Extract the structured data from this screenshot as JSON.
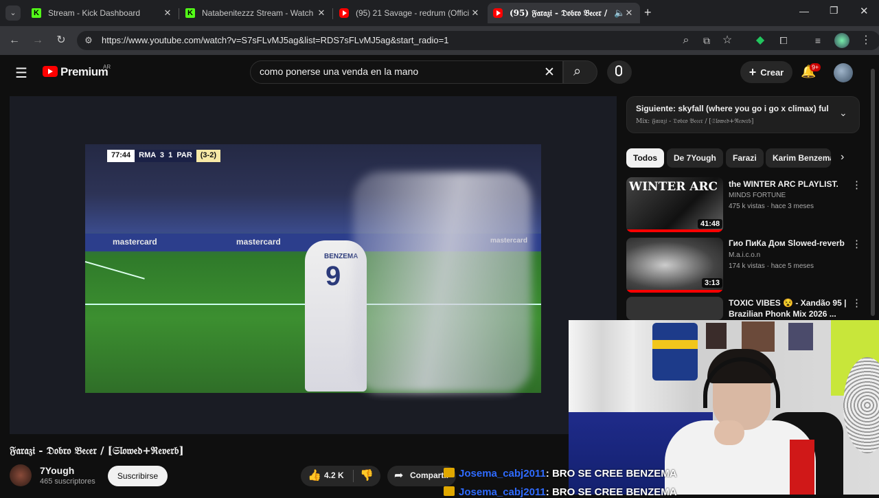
{
  "browser": {
    "tabs": [
      {
        "title": "Stream - Kick Dashboard",
        "favicon": "kick-icon",
        "active": false
      },
      {
        "title": "Natabenitezzz Stream - Watch L",
        "favicon": "kick-icon",
        "active": false
      },
      {
        "title": "(95) 21 Savage - redrum (Offici",
        "favicon": "youtube-icon",
        "active": false
      },
      {
        "title": "(95) 𝔉𝔞𝔯𝔞𝔷𝔦 - 𝔇𝔬𝔟𝔯𝔬 𝔅𝔢𝔠𝔢𝔯 /",
        "favicon": "youtube-icon",
        "active": true
      }
    ],
    "new_tab": "+",
    "url": "https://www.youtube.com/watch?v=S7sFLvMJ5ag&list=RDS7sFLvMJ5ag&start_radio=1"
  },
  "youtube": {
    "logo": "Premium",
    "region": "AR",
    "search_value": "como ponerse una venda en la mano",
    "crear_label": "Crear",
    "notifications_badge": "9+"
  },
  "video": {
    "scoreboard": {
      "time": "77:44",
      "teams": "RMA  3  1  PAR",
      "aggregate": "(3-2)"
    },
    "ad_text": "mastercard",
    "jersey_name": "BENZEMA",
    "jersey_number": "9",
    "title": "𝔉𝔞𝔯𝔞𝔷𝔦 - 𝔇𝔬𝔟𝔯𝔬 𝔅𝔢𝔠𝔢𝔯 / [𝔖𝔩𝔬𝔴𝔢𝔡+ℜ𝔢𝔳𝔢𝔯𝔟]",
    "channel": "7Yough",
    "subscribers": "465 suscriptores",
    "subscribe_label": "Suscribirse",
    "likes": "4.2 K",
    "share_label": "Compartir"
  },
  "sidebar": {
    "next_title": "Siguiente: skyfall (where you go i go x climax) full s...",
    "next_sub": "Mix: 𝔉𝔞𝔯𝔞𝔷𝔦 - 𝔇𝔬𝔟𝔯𝔬 𝔅𝔢𝔠𝔢𝔯 / [𝔖𝔩𝔬𝔴𝔢𝔡+ℜ𝔢𝔳𝔢𝔯𝔟]",
    "chips": [
      "Todos",
      "De 7Yough",
      "Farazi",
      "Karim Benzema"
    ],
    "videos": [
      {
        "title": "the WINTER ARC PLAYLIST.",
        "channel": "MINDS FORTUNE",
        "meta": "475 k vistas · hace 3 meses",
        "duration": "41:48",
        "thumb_text": "WINTER ARC"
      },
      {
        "title": "Гио ПиКа Дом Slowed-reverb",
        "channel": "M.a.i.c.o.n",
        "meta": "174 k vistas · hace 5 meses",
        "duration": "3:13",
        "thumb_text": ""
      },
      {
        "title": "TOXIC VIBES 😵 - Xandão 95 | Brazilian Phonk Mix 2026 ...",
        "channel": "",
        "meta": "",
        "duration": "",
        "thumb_text": ""
      }
    ]
  },
  "chat": [
    {
      "user": "Josema_cabj2011",
      "message": ": BRO SE CREE BENZEMA"
    },
    {
      "user": "Josema_cabj2011",
      "message": ": BRO SE CREE BENZEMA"
    }
  ]
}
